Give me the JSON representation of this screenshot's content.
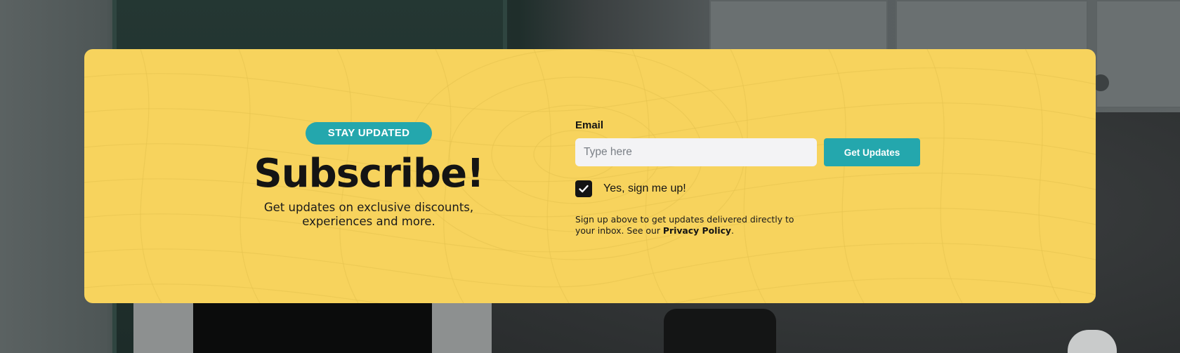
{
  "badge": {
    "label": "STAY UPDATED"
  },
  "heading": {
    "title": "Subscribe!",
    "subtitle_line1": "Get updates on exclusive discounts,",
    "subtitle_line2": "experiences and more."
  },
  "form": {
    "email_label": "Email",
    "email_placeholder": "Type here",
    "email_value": "",
    "submit_label": "Get Updates",
    "consent_checked": true,
    "consent_label": "Yes, sign me up!",
    "fine_print_prefix": "Sign up above to get updates delivered directly to your inbox. See our ",
    "privacy_link_label": "Privacy Policy",
    "fine_print_suffix": "."
  },
  "colors": {
    "card_background": "#f7d35d",
    "accent_teal": "#24a7ad",
    "text_dark": "#141414",
    "input_background": "#f3f3f5"
  },
  "icons": {
    "checkbox": "check-icon"
  }
}
